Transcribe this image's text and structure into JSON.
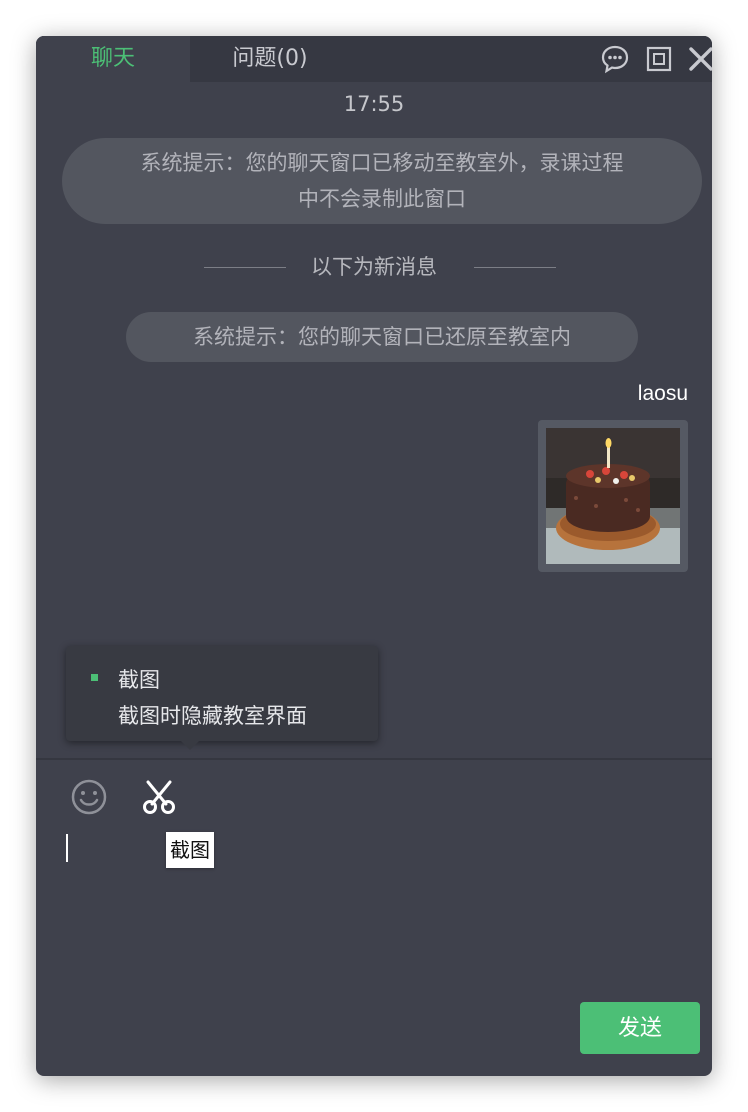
{
  "tabs": [
    {
      "label": "聊天",
      "active": true
    },
    {
      "label": "问题(0)",
      "active": false
    }
  ],
  "window_controls": [
    "chat-bubble-icon",
    "restore-icon",
    "close-icon"
  ],
  "timestamp": "17:55",
  "messages": {
    "system_1_line1": "系统提示：您的聊天窗口已移动至教室外，录课过程",
    "system_1_line2": "中不会录制此窗口",
    "new_messages_divider": "以下为新消息",
    "system_2": "系统提示：您的聊天窗口已还原至教室内",
    "sender": "laosu",
    "image_message": "cake-photo"
  },
  "screenshot_menu": {
    "option_1": "截图",
    "option_2": "截图时隐藏教室界面",
    "selected_option": 1
  },
  "toolbar": {
    "emoji_icon": "smiley-icon",
    "scissors_icon": "scissors-icon",
    "tooltip": "截图"
  },
  "input": {
    "value": ""
  },
  "send_button": {
    "label": "发送"
  },
  "colors": {
    "accent": "#4cbf76",
    "window_bg": "#3f414c",
    "tabbar_bg": "#363842",
    "system_bubble": "#53565f"
  }
}
